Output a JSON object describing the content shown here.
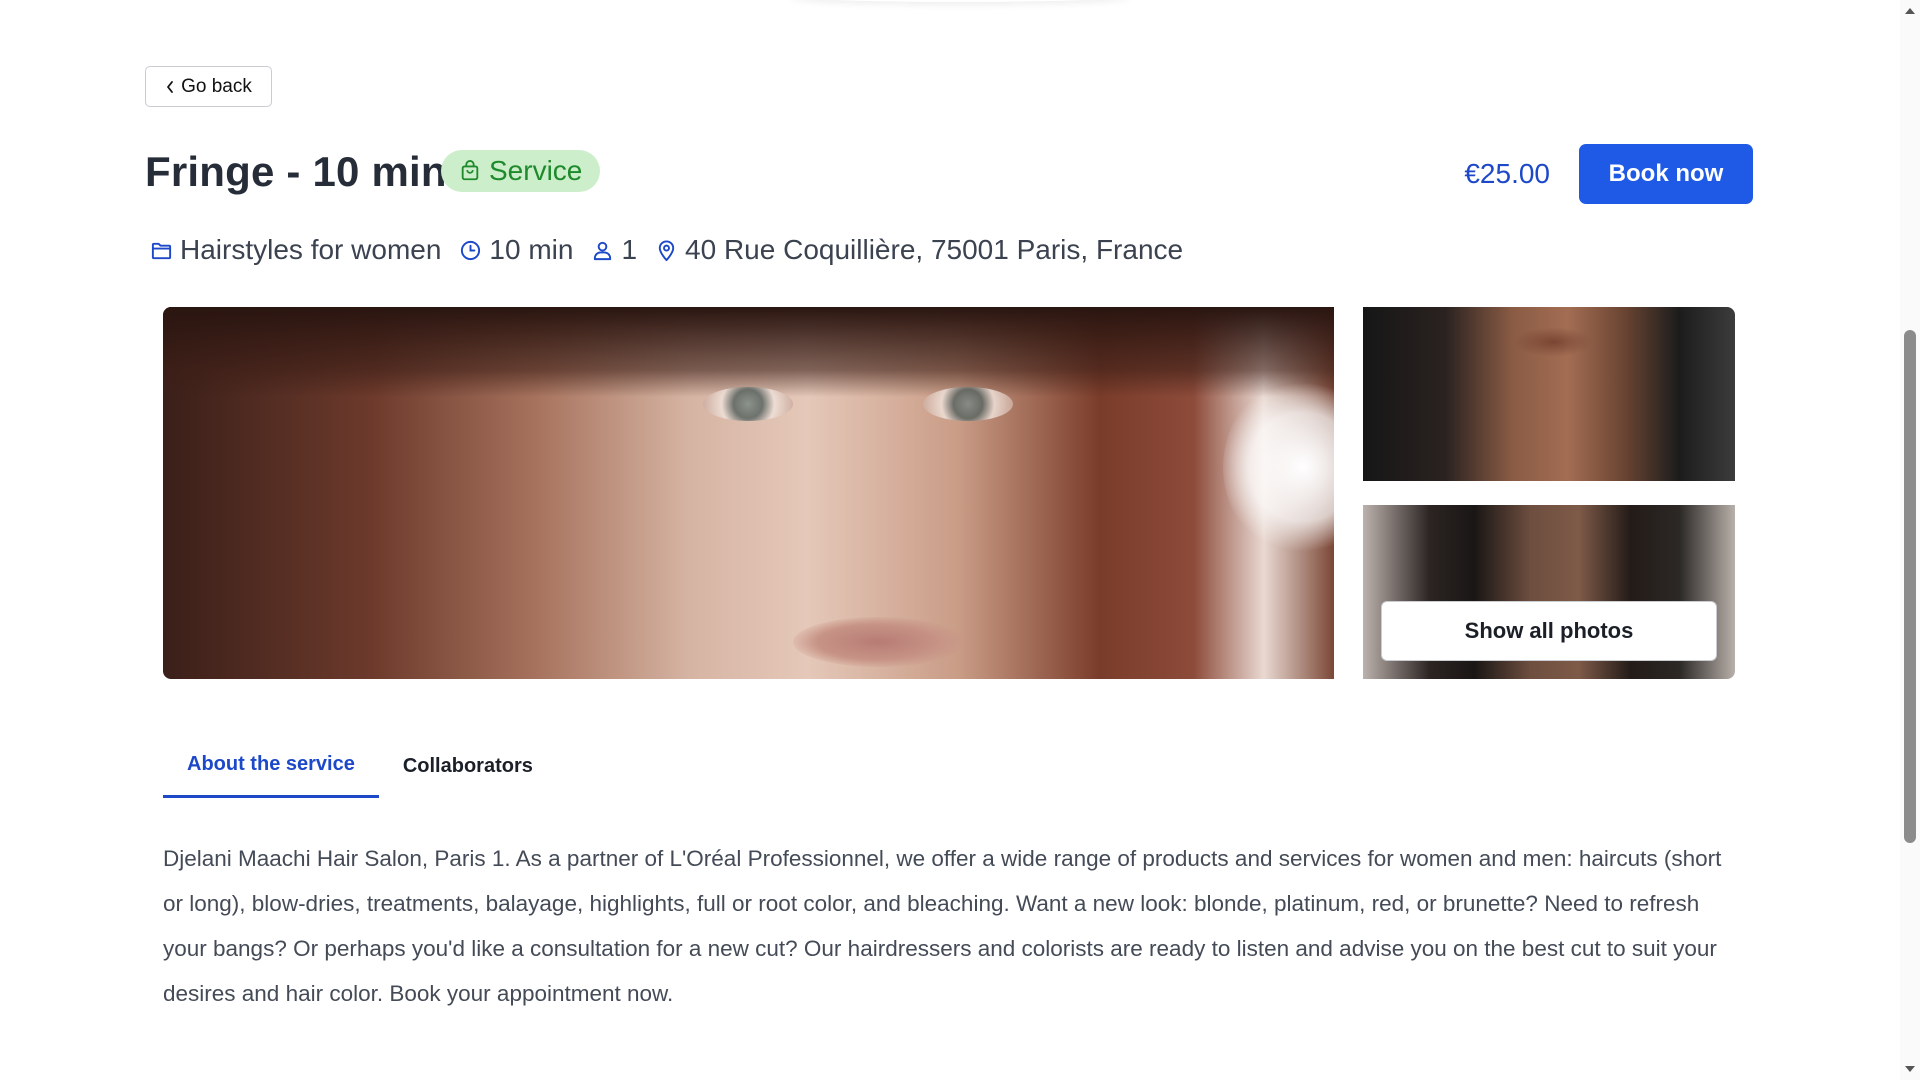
{
  "nav": {
    "go_back_label": "Go back"
  },
  "service": {
    "title": "Fringe - 10 min",
    "badge_label": "Service",
    "price": "€25.00",
    "book_label": "Book now"
  },
  "meta": {
    "category": "Hairstyles for women",
    "duration": "10 min",
    "people": "1",
    "address": "40 Rue Coquillière, 75001 Paris, France"
  },
  "gallery": {
    "show_all_label": "Show all photos"
  },
  "tabs": [
    {
      "label": "About the service",
      "active": true
    },
    {
      "label": "Collaborators",
      "active": false
    }
  ],
  "description": "Djelani Maachi Hair Salon, Paris 1. As a partner of L'Oréal Professionnel, we offer a wide range of products and services for women and men: haircuts (short or long), blow-dries, treatments, balayage, highlights, full or root color, and bleaching. Want a new look: blonde, platinum, red, or brunette? Need to refresh your bangs? Or perhaps you'd like a consultation for a new cut? Our hairdressers and colorists are ready to listen and advise you on the best cut to suit your desires and hair color. Book your appointment now.",
  "colors": {
    "accent": "#1f5ae6",
    "price": "#1d49c9",
    "badge_bg": "#cdeecb",
    "badge_text": "#1f8a2c"
  },
  "icons": {
    "back": "chevron-left-icon",
    "badge": "shopping-bag-icon",
    "category": "folder-icon",
    "duration": "clock-icon",
    "people": "person-icon",
    "address": "map-pin-icon"
  }
}
